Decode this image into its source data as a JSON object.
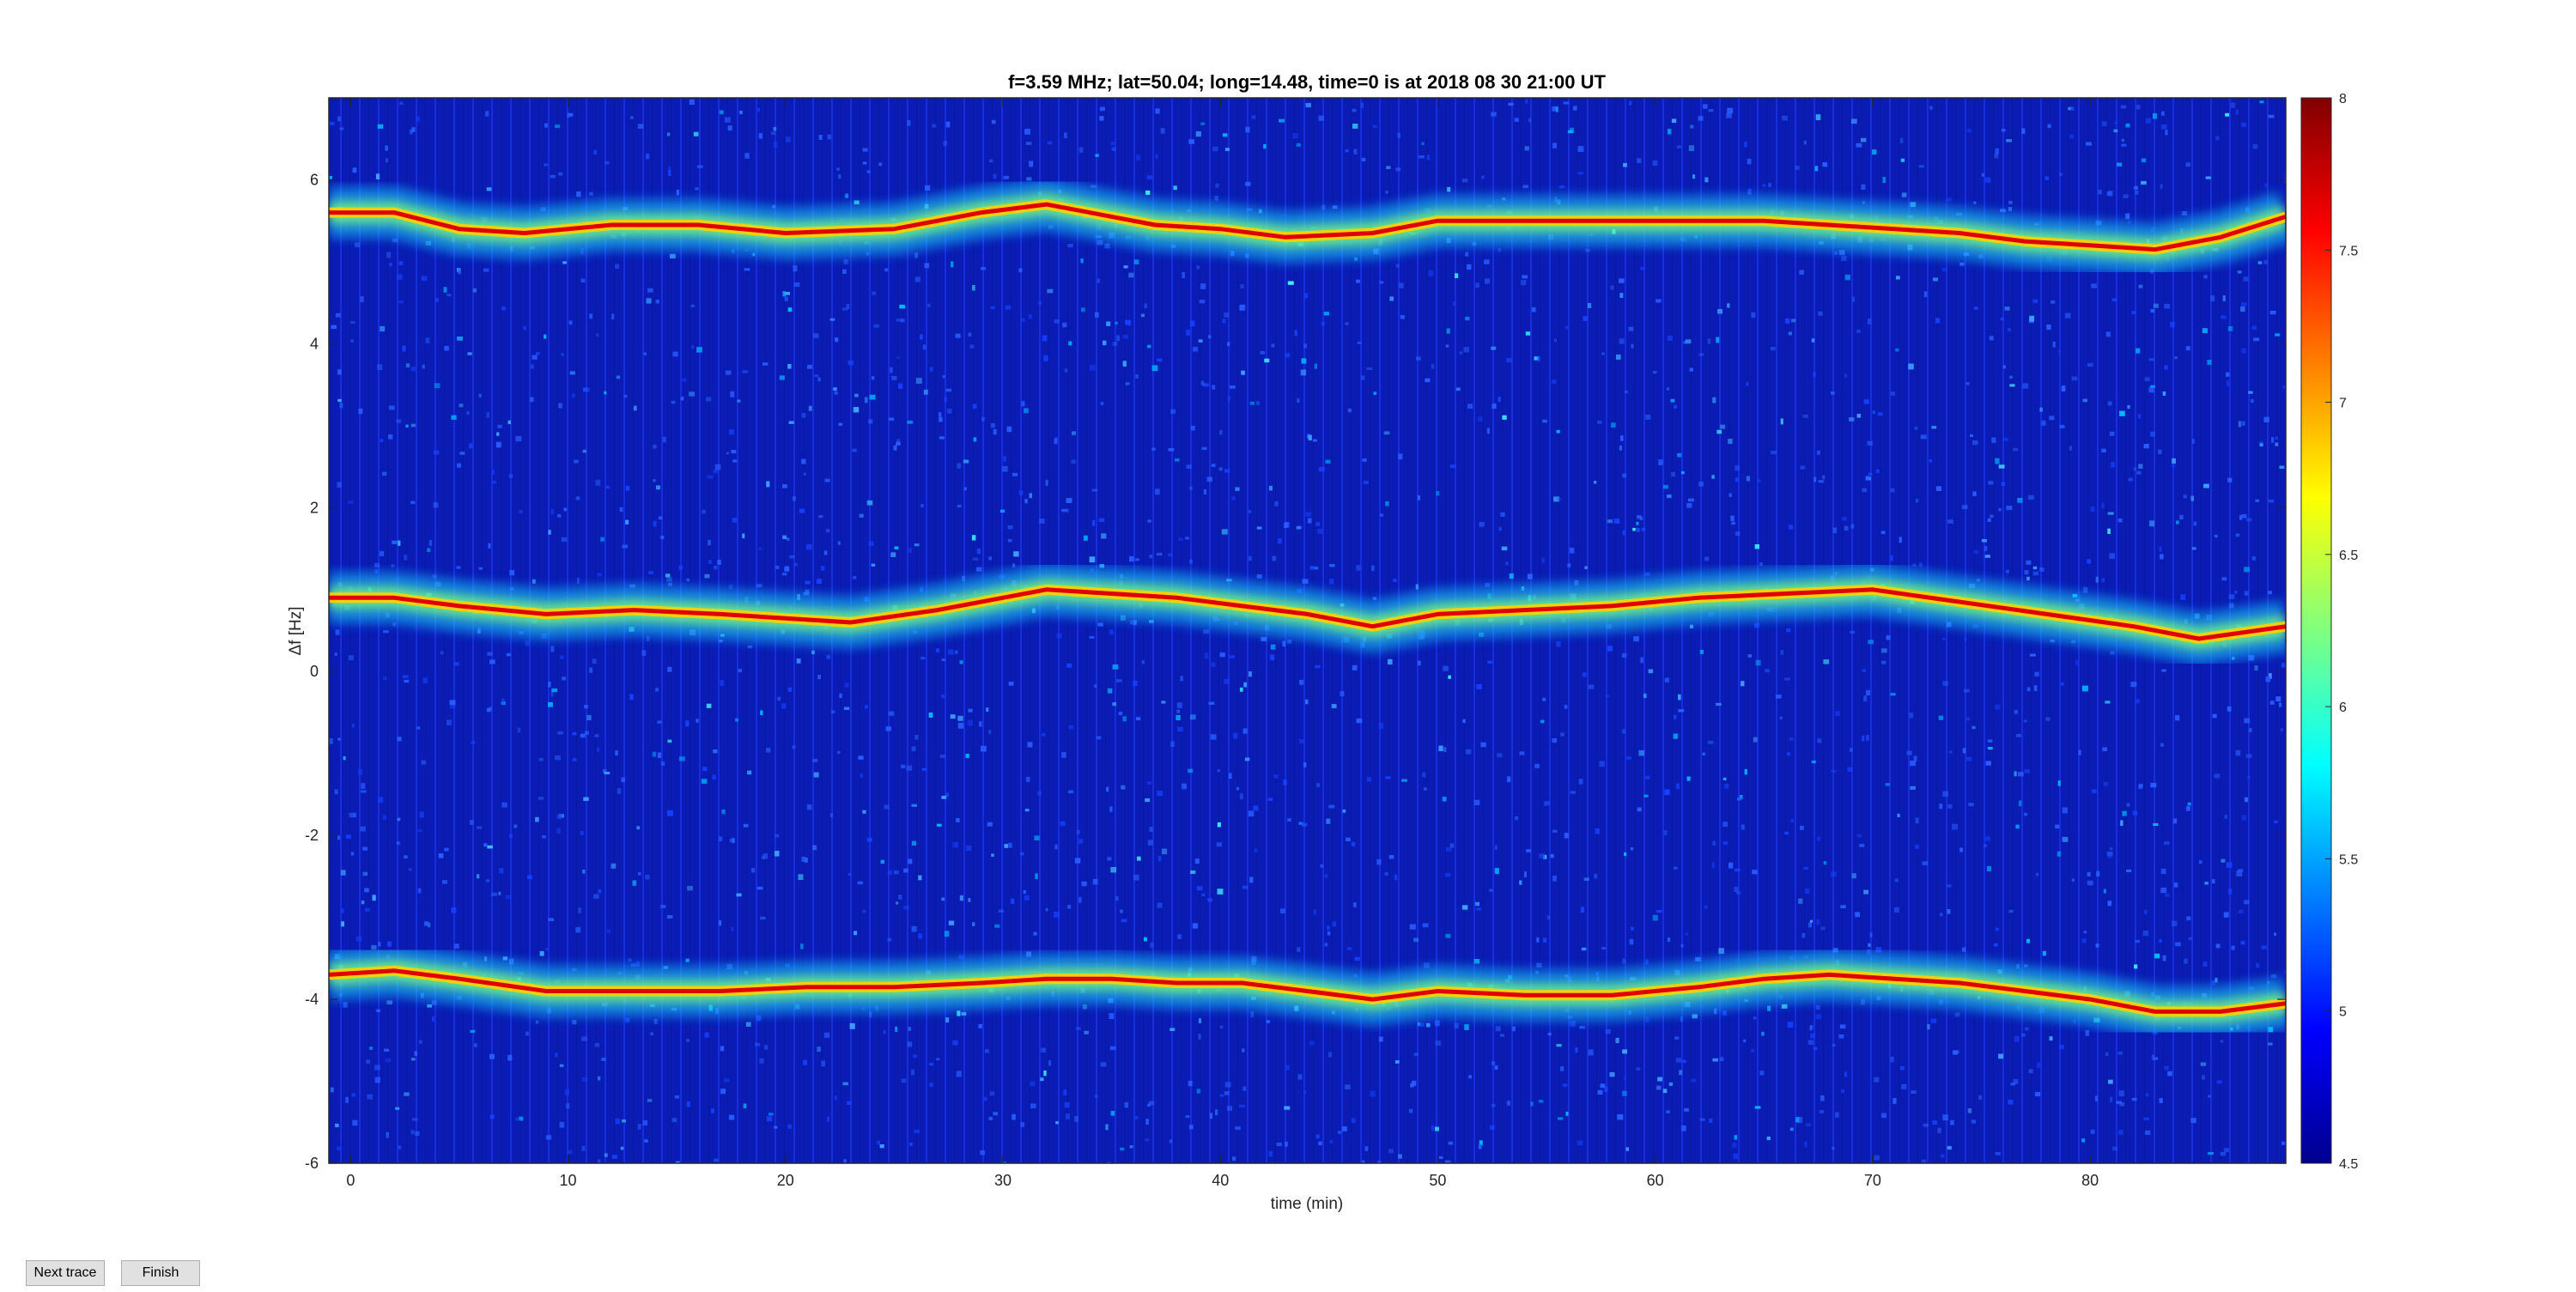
{
  "chart_data": {
    "type": "heatmap",
    "title": "f=3.59 MHz;  lat=50.04; long=14.48, time=0 is at 2018 08 30 21:00 UT",
    "xlabel": "time (min)",
    "ylabel": "Δf [Hz]",
    "xlim": [
      -1,
      89
    ],
    "ylim": [
      -6,
      7
    ],
    "xticks": [
      0,
      10,
      20,
      30,
      40,
      50,
      60,
      70,
      80
    ],
    "yticks": [
      -6,
      -4,
      -2,
      0,
      2,
      4,
      6
    ],
    "colormap": "jet",
    "colorbar": {
      "range": [
        4.5,
        8
      ],
      "ticks": [
        "4.5",
        "5",
        "5.5",
        "6",
        "6.5",
        "7",
        "7.5",
        "8"
      ]
    },
    "series": [
      {
        "x": [
          -1,
          2,
          5,
          8,
          12,
          16,
          20,
          25,
          29,
          32,
          34,
          37,
          40,
          43,
          47,
          50,
          55,
          60,
          65,
          68,
          71,
          74,
          77,
          80,
          83,
          86,
          89
        ],
        "y": [
          5.6,
          5.6,
          5.4,
          5.35,
          5.45,
          5.45,
          5.35,
          5.4,
          5.6,
          5.7,
          5.6,
          5.45,
          5.4,
          5.3,
          5.35,
          5.5,
          5.5,
          5.5,
          5.5,
          5.45,
          5.4,
          5.35,
          5.25,
          5.2,
          5.15,
          5.3,
          5.55
        ]
      },
      {
        "x": [
          -1,
          2,
          5,
          9,
          13,
          17,
          20,
          23,
          27,
          30,
          32,
          35,
          38,
          41,
          44,
          47,
          50,
          54,
          58,
          62,
          66,
          70,
          74,
          78,
          82,
          85,
          89
        ],
        "y": [
          0.9,
          0.9,
          0.8,
          0.7,
          0.75,
          0.7,
          0.65,
          0.6,
          0.75,
          0.9,
          1.0,
          0.95,
          0.9,
          0.8,
          0.7,
          0.55,
          0.7,
          0.75,
          0.8,
          0.9,
          0.95,
          1.0,
          0.85,
          0.7,
          0.55,
          0.4,
          0.55
        ]
      },
      {
        "x": [
          -1,
          2,
          5,
          9,
          13,
          17,
          21,
          25,
          29,
          32,
          35,
          38,
          41,
          44,
          47,
          50,
          54,
          58,
          62,
          65,
          68,
          71,
          74,
          77,
          80,
          83,
          86,
          89
        ],
        "y": [
          -3.7,
          -3.65,
          -3.75,
          -3.9,
          -3.9,
          -3.9,
          -3.85,
          -3.85,
          -3.8,
          -3.75,
          -3.75,
          -3.8,
          -3.8,
          -3.9,
          -4.0,
          -3.9,
          -3.95,
          -3.95,
          -3.85,
          -3.75,
          -3.7,
          -3.75,
          -3.8,
          -3.9,
          -4.0,
          -4.15,
          -4.15,
          -4.05
        ]
      }
    ]
  },
  "buttons": {
    "next_trace": "Next trace",
    "finish": "Finish"
  }
}
